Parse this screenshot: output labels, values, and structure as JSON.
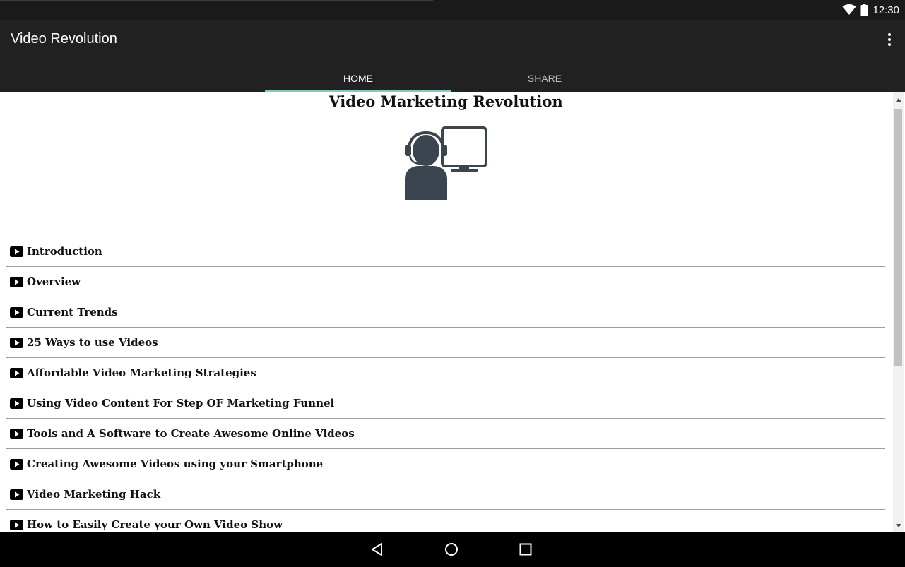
{
  "status_bar": {
    "time": "12:30",
    "icons": [
      "wifi-icon",
      "battery-icon"
    ]
  },
  "app_bar": {
    "title": "Video Revolution",
    "overflow_icon": "more-vert-icon"
  },
  "tabs": [
    {
      "label": "HOME",
      "active": true
    },
    {
      "label": "SHARE",
      "active": false
    }
  ],
  "content": {
    "heading": "Video Marketing Revolution",
    "hero_icon": "user-at-computer-icon",
    "items": [
      {
        "label": "Introduction"
      },
      {
        "label": "Overview"
      },
      {
        "label": "Current Trends"
      },
      {
        "label": "25 Ways to use Videos"
      },
      {
        "label": "Affordable Video Marketing Strategies"
      },
      {
        "label": "Using Video Content For Step OF Marketing Funnel"
      },
      {
        "label": "Tools and A Software to Create Awesome Online Videos"
      },
      {
        "label": "Creating Awesome Videos using your Smartphone"
      },
      {
        "label": "Video Marketing Hack"
      },
      {
        "label": "How to Easily Create your Own Video Show"
      }
    ]
  },
  "nav_bar": {
    "buttons": [
      "back-icon",
      "home-icon",
      "recents-icon"
    ]
  },
  "colors": {
    "status_bar": "#1a1a1a",
    "app_bar": "#212121",
    "tab_indicator": "#80cbc4",
    "icon_dark": "#3b4550"
  }
}
